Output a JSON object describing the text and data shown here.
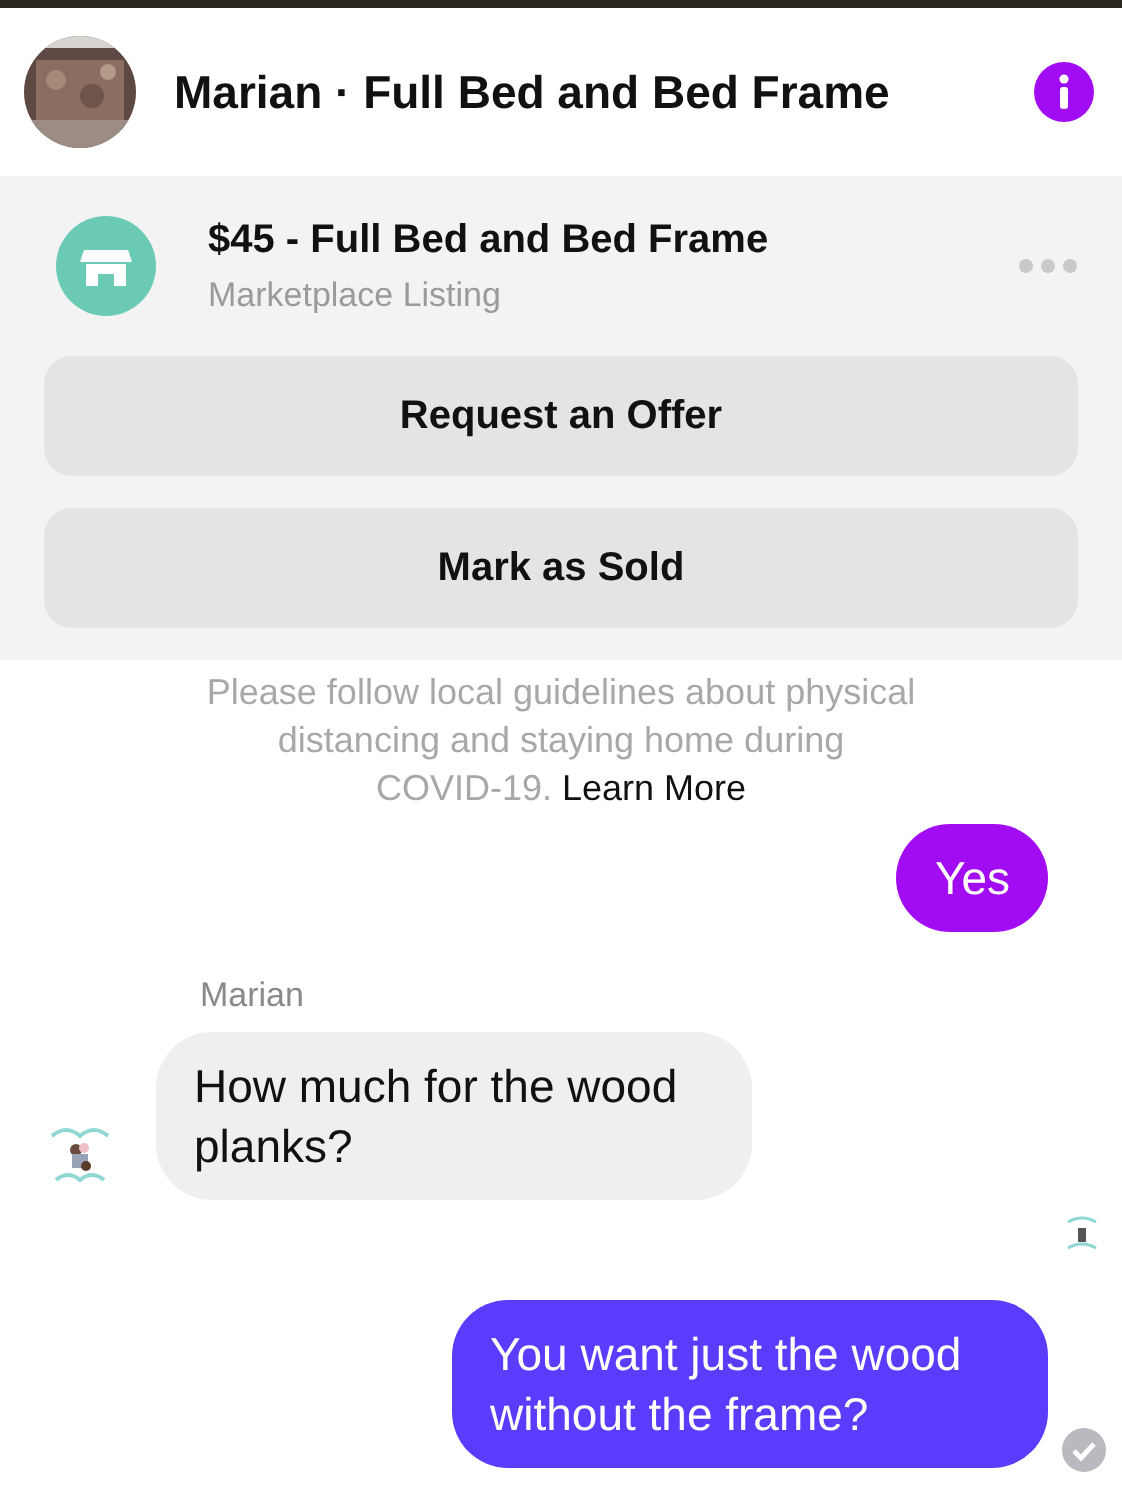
{
  "header": {
    "title": "Marian · Full Bed and Bed Frame"
  },
  "listing": {
    "title": "$45 - Full Bed and Bed Frame",
    "subtitle": "Marketplace Listing"
  },
  "actions": [
    "Request an Offer",
    "Mark as Sold"
  ],
  "notice": {
    "lines": [
      "Please follow local guidelines about physical",
      "distancing and staying home during"
    ],
    "tail": "COVID-19.",
    "link": "Learn More"
  },
  "messages": [
    {
      "kind": "sent",
      "text": "Yes",
      "color": "#a20cf2",
      "read": false
    },
    {
      "kind": "sender",
      "text": "Marian"
    },
    {
      "kind": "received",
      "text": "How much for the wood planks?"
    },
    {
      "kind": "sent",
      "text": "You want just the wood without the frame?",
      "color": "#5b3bfc",
      "read": true
    }
  ]
}
